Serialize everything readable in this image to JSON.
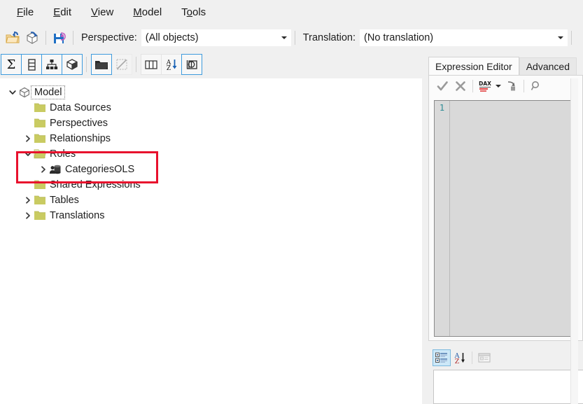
{
  "menu": {
    "items": [
      {
        "name": "file",
        "pre": "",
        "mn": "F",
        "post": "ile"
      },
      {
        "name": "edit",
        "pre": "",
        "mn": "E",
        "post": "dit"
      },
      {
        "name": "view",
        "pre": "",
        "mn": "V",
        "post": "iew"
      },
      {
        "name": "model",
        "pre": "",
        "mn": "M",
        "post": "odel"
      },
      {
        "name": "tools",
        "pre": "T",
        "mn": "o",
        "post": "ols"
      }
    ]
  },
  "toolbar1": {
    "open_icon": "open-folder-icon",
    "refresh_icon": "refresh-model-icon",
    "save_icon": "save-icon",
    "perspective_label": "Perspective:",
    "perspective_value": "(All objects)",
    "translation_label": "Translation:",
    "translation_value": "(No translation)"
  },
  "toolbar2": {
    "buttons": [
      {
        "name": "new-measure-button",
        "icon": "sigma-icon",
        "state": "active"
      },
      {
        "name": "new-column-button",
        "icon": "column-icon",
        "state": "active"
      },
      {
        "name": "new-hierarchy-button",
        "icon": "hierarchy-icon",
        "state": "active"
      },
      {
        "name": "new-calc-item-button",
        "icon": "cube-icon",
        "state": "active"
      },
      {
        "name": "new-folder-button",
        "icon": "folder-icon",
        "state": "active"
      },
      {
        "name": "new-relationship-button",
        "icon": "diagonal-icon",
        "state": "disabled"
      },
      {
        "name": "show-columns-button",
        "icon": "table-columns-icon",
        "state": "normal"
      },
      {
        "name": "sort-alpha-button",
        "icon": "sort-az-icon",
        "state": "normal"
      },
      {
        "name": "show-hidden-button",
        "icon": "perspective-icon",
        "state": "active"
      }
    ]
  },
  "tree": {
    "nodes": [
      {
        "name": "tree-node-model",
        "label": "Model",
        "depth": 0,
        "twist": "down",
        "icon": "model-cube-icon",
        "focused": true
      },
      {
        "name": "tree-node-data-sources",
        "label": "Data Sources",
        "depth": 1,
        "twist": "none",
        "icon": "folder-icon",
        "focused": false
      },
      {
        "name": "tree-node-perspectives",
        "label": "Perspectives",
        "depth": 1,
        "twist": "none",
        "icon": "folder-icon",
        "focused": false
      },
      {
        "name": "tree-node-relationships",
        "label": "Relationships",
        "depth": 1,
        "twist": "right",
        "icon": "folder-icon",
        "focused": false
      },
      {
        "name": "tree-node-roles",
        "label": "Roles",
        "depth": 1,
        "twist": "down",
        "icon": "folder-open-icon",
        "focused": false
      },
      {
        "name": "tree-node-categoriesols",
        "label": "CategoriesOLS",
        "depth": 2,
        "twist": "right",
        "icon": "role-icon",
        "focused": false
      },
      {
        "name": "tree-node-shared-expressions",
        "label": "Shared Expressions",
        "depth": 1,
        "twist": "none",
        "icon": "folder-icon",
        "focused": false
      },
      {
        "name": "tree-node-tables",
        "label": "Tables",
        "depth": 1,
        "twist": "right",
        "icon": "folder-icon",
        "focused": false
      },
      {
        "name": "tree-node-translations",
        "label": "Translations",
        "depth": 1,
        "twist": "right",
        "icon": "folder-icon",
        "focused": false
      }
    ],
    "highlight_color": "#e8112d",
    "folder_color": "#c9cb62"
  },
  "right": {
    "tabs": [
      {
        "name": "tab-expression-editor",
        "label": "Expression Editor",
        "selected": true
      },
      {
        "name": "tab-advanced",
        "label": "Advanced",
        "selected": false
      }
    ],
    "editor_toolbar": [
      {
        "name": "accept-expression-button",
        "icon": "check-icon",
        "state": "disabled"
      },
      {
        "name": "cancel-expression-button",
        "icon": "cross-icon",
        "state": "disabled"
      },
      {
        "name": "dax-formatter-button",
        "icon": "dax-format-icon",
        "state": "normal"
      },
      {
        "name": "dax-formatter-dropdown",
        "icon": "chevron-down-icon",
        "state": "normal"
      },
      {
        "name": "indent-expression-button",
        "icon": "indent-icon",
        "state": "normal"
      },
      {
        "name": "find-button",
        "icon": "search-icon",
        "state": "normal"
      }
    ],
    "code_line_number": "1",
    "code_text": "",
    "properties_toolbar": [
      {
        "name": "categorized-view-button",
        "icon": "categorized-icon",
        "state": "active"
      },
      {
        "name": "alphabetical-sort-button",
        "icon": "sort-az-icon",
        "state": "normal"
      },
      {
        "name": "property-pages-button",
        "icon": "property-page-icon",
        "state": "disabled"
      }
    ]
  }
}
